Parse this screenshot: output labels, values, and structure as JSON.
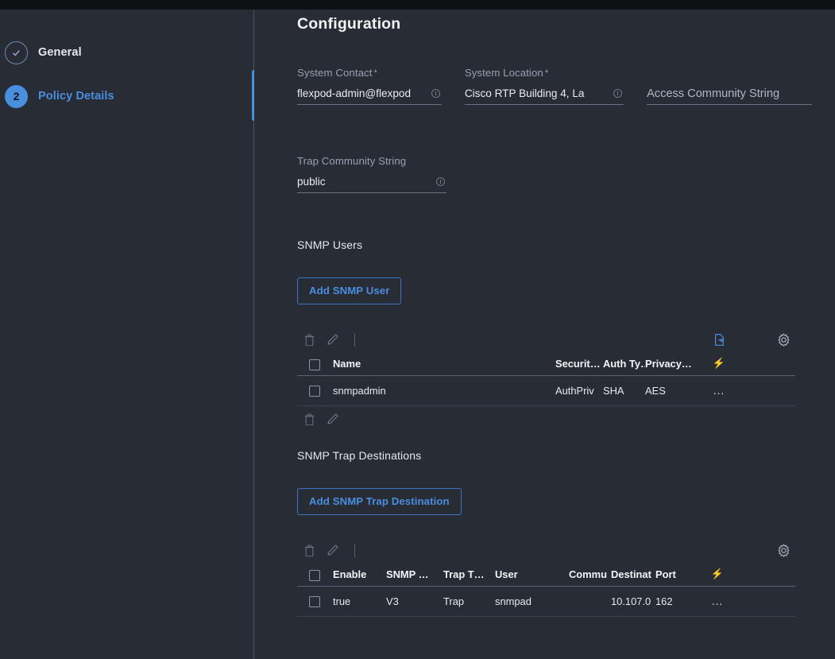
{
  "window": {
    "accent_blue": "#4a8ee0",
    "background": "#282c34",
    "topbar_color": "#0e1014"
  },
  "sidebar": {
    "items": [
      {
        "marker": "check-icon",
        "label": "General",
        "state": "completed"
      },
      {
        "marker": "2",
        "label": "Policy Details",
        "state": "active"
      }
    ]
  },
  "main": {
    "title": "Configuration",
    "fields": [
      {
        "label": "System Contact",
        "required": "*",
        "value": "flexpod-admin@flexpod",
        "info_icon": "info-icon"
      },
      {
        "label": "System Location",
        "required": "*",
        "value": "Cisco  RTP Building 4, La",
        "info_icon": "info-icon"
      },
      {
        "label": "",
        "required": "",
        "placeholder": "Access Community String",
        "value": ""
      },
      {
        "label": "Trap Community String",
        "required": "",
        "value": "public",
        "info_icon": "info-icon"
      }
    ],
    "snmp_users": {
      "section_title": "SNMP Users",
      "add_button": "Add SNMP User",
      "toolbar_icons": [
        "trash-icon",
        "pencil-icon",
        "export-icon",
        "gear-icon"
      ],
      "columns": [
        "Name",
        "Securit…",
        "Auth Ty…",
        "Privacy…"
      ],
      "action_column_icon": "lightning-icon",
      "rows": [
        {
          "name": "snmpadmin",
          "security_level": "AuthPriv",
          "auth_type": "SHA",
          "privacy_type": "AES",
          "actions": "…"
        }
      ],
      "footer_icons": [
        "trash-icon",
        "pencil-icon"
      ]
    },
    "snmp_trap_destinations": {
      "section_title": "SNMP Trap Destinations",
      "add_button": "Add SNMP Trap Destination",
      "toolbar_icons": [
        "trash-icon",
        "pencil-icon",
        "gear-icon"
      ],
      "columns": [
        "Enable",
        "SNMP …",
        "Trap T…",
        "User",
        "Commu",
        "Destinat",
        "Port"
      ],
      "action_column_icon": "lightning-icon",
      "rows": [
        {
          "enable": "true",
          "snmp_version": "V3",
          "trap_type": "Trap",
          "user": "snmpad",
          "community": "",
          "destination": "10.107.0",
          "port": "162",
          "actions": "…"
        }
      ]
    }
  }
}
